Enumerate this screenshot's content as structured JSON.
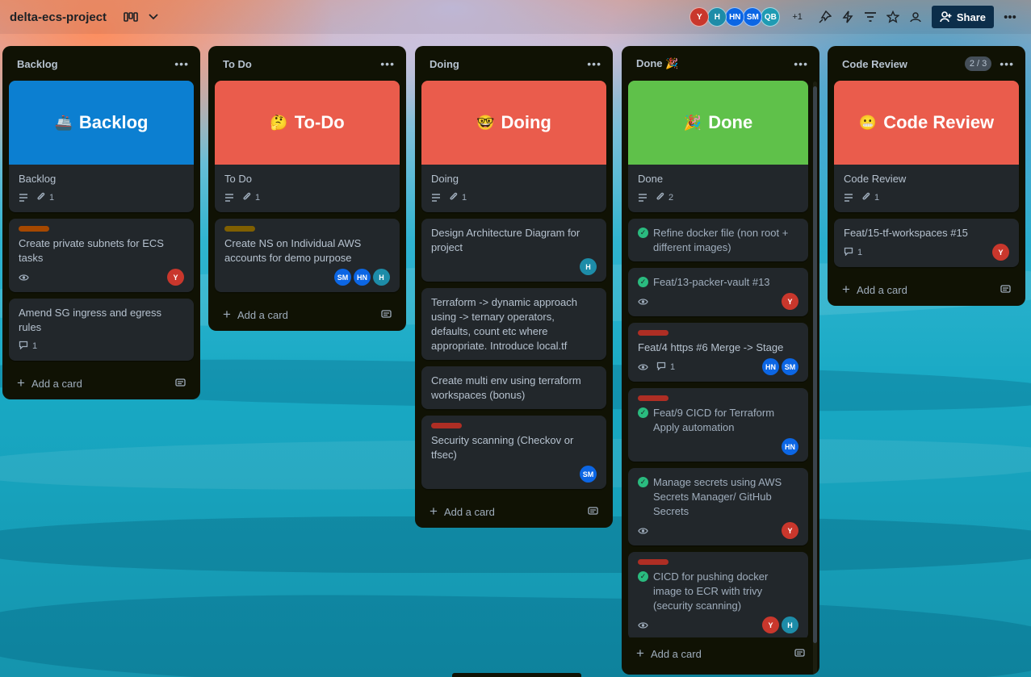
{
  "board": {
    "title": "delta-ecs-project",
    "header_avatars": [
      {
        "initials": "Y",
        "color": "#c9372c"
      },
      {
        "initials": "H",
        "color": "#1d8ca8"
      },
      {
        "initials": "HN",
        "color": "#0c66e4"
      },
      {
        "initials": "SM",
        "color": "#0c66e4"
      },
      {
        "initials": "QB",
        "color": "#1f9bb3"
      }
    ],
    "extra_members": "+1",
    "share_label": "Share"
  },
  "lists": [
    {
      "title": "Backlog",
      "cover_card": {
        "cover_text": "Backlog",
        "cover_emoji": "🚢",
        "cover_color": "#0c7fd1",
        "title": "Backlog",
        "attachments": "1"
      },
      "cards": [
        {
          "title": "Create private subnets for ECS tasks",
          "label_color": "#a54800",
          "watch": true,
          "members": [
            "Y"
          ]
        },
        {
          "title": "Amend SG ingress and egress rules",
          "comments": "1"
        }
      ],
      "add_label": "Add a card"
    },
    {
      "title": "To Do",
      "cover_card": {
        "cover_text": "To-Do",
        "cover_emoji": "🤔",
        "cover_color": "#ea5c4c",
        "title": "To Do",
        "attachments": "1"
      },
      "cards": [
        {
          "title": "Create NS on Individual AWS accounts for demo purpose",
          "label_color": "#7f5f01",
          "members": [
            "SM",
            "HN",
            "H"
          ]
        }
      ],
      "add_label": "Add a card"
    },
    {
      "title": "Doing",
      "cover_card": {
        "cover_text": "Doing",
        "cover_emoji": "🤓",
        "cover_color": "#ea5c4c",
        "title": "Doing",
        "attachments": "1"
      },
      "cards": [
        {
          "title": "Design Architecture Diagram for project",
          "members": [
            "H"
          ]
        },
        {
          "title": "Terraform -> dynamic approach using -> ternary operators, defaults, count etc where appropriate. Introduce local.tf"
        },
        {
          "title": "Create multi env using terraform workspaces (bonus)"
        },
        {
          "title": "Security scanning (Checkov or tfsec)",
          "label_color": "#ae2e24",
          "members": [
            "SM"
          ]
        }
      ],
      "add_label": "Add a card"
    },
    {
      "title": "Done 🎉",
      "cover_card": {
        "cover_text": "Done",
        "cover_emoji": "🎉",
        "cover_color": "#5fc14a",
        "title": "Done",
        "attachments": "2"
      },
      "cards": [
        {
          "title": "Refine docker file (non root + different images)",
          "done": true
        },
        {
          "title": "Feat/13-packer-vault #13",
          "done": true,
          "watch": true,
          "members": [
            "Y"
          ]
        },
        {
          "title": "Feat/4 https #6 Merge -> Stage",
          "label_color": "#ae2e24",
          "watch": true,
          "comments": "1",
          "members": [
            "HN",
            "SM"
          ]
        },
        {
          "title": "Feat/9 CICD for Terraform Apply automation",
          "label_color": "#ae2e24",
          "done": true,
          "members": [
            "HN"
          ]
        },
        {
          "title": "Manage secrets using AWS Secrets Manager/ GitHub Secrets",
          "done": true,
          "watch": true,
          "members": [
            "Y"
          ]
        },
        {
          "title": "CICD for pushing docker image to ECR with trivy (security scanning)",
          "label_color": "#ae2e24",
          "done": true,
          "watch": true,
          "members": [
            "Y",
            "H"
          ]
        },
        {
          "title": "",
          "label_color": "#ae2e24"
        }
      ],
      "add_label": "Add a card"
    },
    {
      "title": "Code Review",
      "limit": "2 / 3",
      "cover_card": {
        "cover_text": "Code Review",
        "cover_emoji": "😬",
        "cover_color": "#ea5c4c",
        "title": "Code Review",
        "attachments": "1"
      },
      "cards": [
        {
          "title": "Feat/15-tf-workspaces #15",
          "comments": "1",
          "members": [
            "Y"
          ]
        }
      ],
      "add_label": "Add a card"
    }
  ]
}
